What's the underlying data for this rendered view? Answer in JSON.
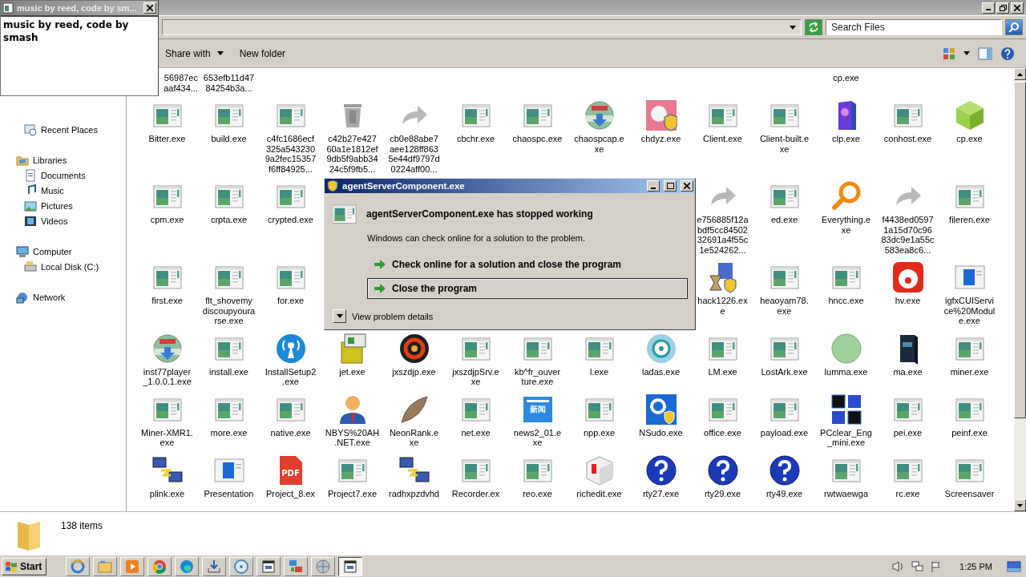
{
  "popup": {
    "title": "music by reed, code by sm...",
    "text": "music by reed, code by smash"
  },
  "explorer": {
    "search": {
      "placeholder": "Search Files"
    },
    "toolbar": [
      {
        "label": "Share with",
        "kind": "menu"
      },
      {
        "label": "New folder",
        "kind": "plain"
      }
    ],
    "sidebar": [
      {
        "children": [
          {
            "label": "Recent Places",
            "kind": "recent"
          }
        ]
      },
      {
        "label": "Libraries",
        "kind": "library",
        "children": [
          {
            "label": "Documents",
            "kind": "documents"
          },
          {
            "label": "Music",
            "kind": "music"
          },
          {
            "label": "Pictures",
            "kind": "pictures"
          },
          {
            "label": "Videos",
            "kind": "videos"
          }
        ]
      },
      {
        "label": "Computer",
        "kind": "computer",
        "children": [
          {
            "label": "Local Disk (C:)",
            "kind": "disk"
          }
        ]
      },
      {
        "label": "Network",
        "kind": "network"
      }
    ],
    "partial_row": [
      {
        "label": "56987ec\naaf434..."
      },
      {
        "label": "653efb11d47\n84254b3a..."
      },
      {
        "label": "cp.exe"
      }
    ],
    "rows": [
      {
        "items": [
          {
            "label": "Bitter.exe",
            "kind": "app"
          },
          {
            "label": "build.exe",
            "kind": "app"
          },
          {
            "label": "c4fc1686ecf\n325a543230\n9a2fec15357\nf6ff84925...",
            "kind": "app"
          },
          {
            "label": "c42b27e427\n60a1e1812ef\n9db5f9abb34\n24c5f9fb5...",
            "kind": "bin"
          },
          {
            "label": "cb0e88abe7\naee128ff863\n5e44df9797d\n0224aff00...",
            "kind": "arrow"
          },
          {
            "label": "cbchr.exe",
            "kind": "app"
          },
          {
            "label": "chaospc.exe",
            "kind": "app"
          },
          {
            "label": "chaospcap.e\nxe",
            "kind": "globe"
          },
          {
            "label": "chdyz.exe",
            "kind": "shield"
          },
          {
            "label": "Client.exe",
            "kind": "app"
          },
          {
            "label": "Client-built.e\nxe",
            "kind": "app"
          },
          {
            "label": "clp.exe",
            "kind": "box"
          },
          {
            "label": "conhost.exe",
            "kind": "app"
          },
          {
            "label": "cp.exe",
            "kind": "cube"
          }
        ]
      },
      {
        "items": [
          {
            "label": "cpm.exe",
            "kind": "app"
          },
          {
            "label": "crpta.exe",
            "kind": "app"
          },
          {
            "label": "crypted.exe",
            "kind": "app"
          },
          {
            "label": "e756885f12a\nbdf5cc84502\n32691a4f55c\n1e524262...",
            "kind": "arrow"
          },
          {
            "label": "ed.exe",
            "kind": "app"
          },
          {
            "label": "Everything.e\nxe",
            "kind": "magnifier"
          },
          {
            "label": "f4438ed0597\n1a15d70c96\n83dc9e1a55c\n583ea8c6...",
            "kind": "arrow"
          },
          {
            "label": "fileren.exe",
            "kind": "app"
          }
        ]
      },
      {
        "items": [
          {
            "label": "first.exe",
            "kind": "app"
          },
          {
            "label": "flt_shovemy\ndiscoupyoura\nrse.exe",
            "kind": "app"
          },
          {
            "label": "for.exe",
            "kind": "app"
          },
          {
            "label": "hack1226.ex\ne",
            "kind": "hack"
          },
          {
            "label": "heaoyam78.\nexe",
            "kind": "app"
          },
          {
            "label": "hncc.exe",
            "kind": "app"
          },
          {
            "label": "hv.exe",
            "kind": "record"
          },
          {
            "label": "igfxCUIServi\nce%20Modul\ne.exe",
            "kind": "window"
          }
        ]
      },
      {
        "items": [
          {
            "label": "inst77player\n_1.0.0.1.exe",
            "kind": "globe"
          },
          {
            "label": "install.exe",
            "kind": "app"
          },
          {
            "label": "InstallSetup2\n.exe",
            "kind": "antenna"
          },
          {
            "label": "jet.exe",
            "kind": "package"
          },
          {
            "label": "jxszdjp.exe",
            "kind": "ball"
          },
          {
            "label": "jxszdjpSrv.e\nxe",
            "kind": "app"
          },
          {
            "label": "kb^fr_ouver\nture.exe",
            "kind": "app"
          },
          {
            "label": "l.exe",
            "kind": "app"
          },
          {
            "label": "ladas.exe",
            "kind": "eye"
          },
          {
            "label": "LM.exe",
            "kind": "app"
          },
          {
            "label": "LostArk.exe",
            "kind": "app"
          },
          {
            "label": "lumma.exe",
            "kind": "greenball"
          },
          {
            "label": "ma.exe",
            "kind": "darkbox"
          },
          {
            "label": "miner.exe",
            "kind": "app"
          }
        ]
      },
      {
        "items": [
          {
            "label": "Miner-XMR1.\nexe",
            "kind": "app"
          },
          {
            "label": "more.exe",
            "kind": "app"
          },
          {
            "label": "native.exe",
            "kind": "app"
          },
          {
            "label": "NBYS%20AH\n.NET.exe",
            "kind": "person"
          },
          {
            "label": "NeonRank.e\nxe",
            "kind": "feather"
          },
          {
            "label": "net.exe",
            "kind": "app"
          },
          {
            "label": "news2_01.e\nxe",
            "kind": "news",
            "icon_text": "新闻"
          },
          {
            "label": "npp.exe",
            "kind": "app"
          },
          {
            "label": "NSudo.exe",
            "kind": "gear"
          },
          {
            "label": "office.exe",
            "kind": "app"
          },
          {
            "label": "payload.exe",
            "kind": "app"
          },
          {
            "label": "PCclear_Eng\n_mini.exe",
            "kind": "cubes"
          },
          {
            "label": "pei.exe",
            "kind": "app"
          },
          {
            "label": "peinf.exe",
            "kind": "app"
          }
        ]
      },
      {
        "items": [
          {
            "label": "plink.exe",
            "kind": "computers"
          },
          {
            "label": "Presentation",
            "kind": "window"
          },
          {
            "label": "Project_8.ex",
            "kind": "pdf",
            "icon_text": "PDF"
          },
          {
            "label": "Project7.exe",
            "kind": "app"
          },
          {
            "label": "radhxpzdvhd",
            "kind": "computers"
          },
          {
            "label": "Recorder.ex",
            "kind": "app"
          },
          {
            "label": "reo.exe",
            "kind": "app"
          },
          {
            "label": "richedit.exe",
            "kind": "dice"
          },
          {
            "label": "rty27.exe",
            "kind": "question"
          },
          {
            "label": "rty29.exe",
            "kind": "question"
          },
          {
            "label": "rty49.exe",
            "kind": "question"
          },
          {
            "label": "rwtwaewga",
            "kind": "app"
          },
          {
            "label": "rc.exe",
            "kind": "app"
          },
          {
            "label": "Screensaver",
            "kind": "app"
          }
        ]
      }
    ],
    "status": "138 items"
  },
  "dialog": {
    "title": "agentServerComponent.exe",
    "headline": "agentServerComponent.exe has stopped working",
    "message": "Windows can check online for a solution to the problem.",
    "options": [
      {
        "label": "Check online for a solution and close the program",
        "selected": false
      },
      {
        "label": "Close the program",
        "selected": true
      }
    ],
    "details": "View problem details"
  },
  "taskbar": {
    "start": "Start",
    "buttons": [
      {
        "kind": "ie",
        "selected": false
      },
      {
        "kind": "explorer",
        "selected": false
      },
      {
        "kind": "player",
        "selected": false
      },
      {
        "kind": "chrome",
        "selected": false
      },
      {
        "kind": "edge",
        "selected": false
      },
      {
        "kind": "download",
        "selected": false
      },
      {
        "kind": "disc",
        "selected": false
      },
      {
        "kind": "window",
        "selected": false
      },
      {
        "kind": "computers",
        "selected": false
      },
      {
        "kind": "globe",
        "selected": false
      },
      {
        "kind": "window",
        "selected": true
      }
    ],
    "clock": "1:25 PM"
  }
}
